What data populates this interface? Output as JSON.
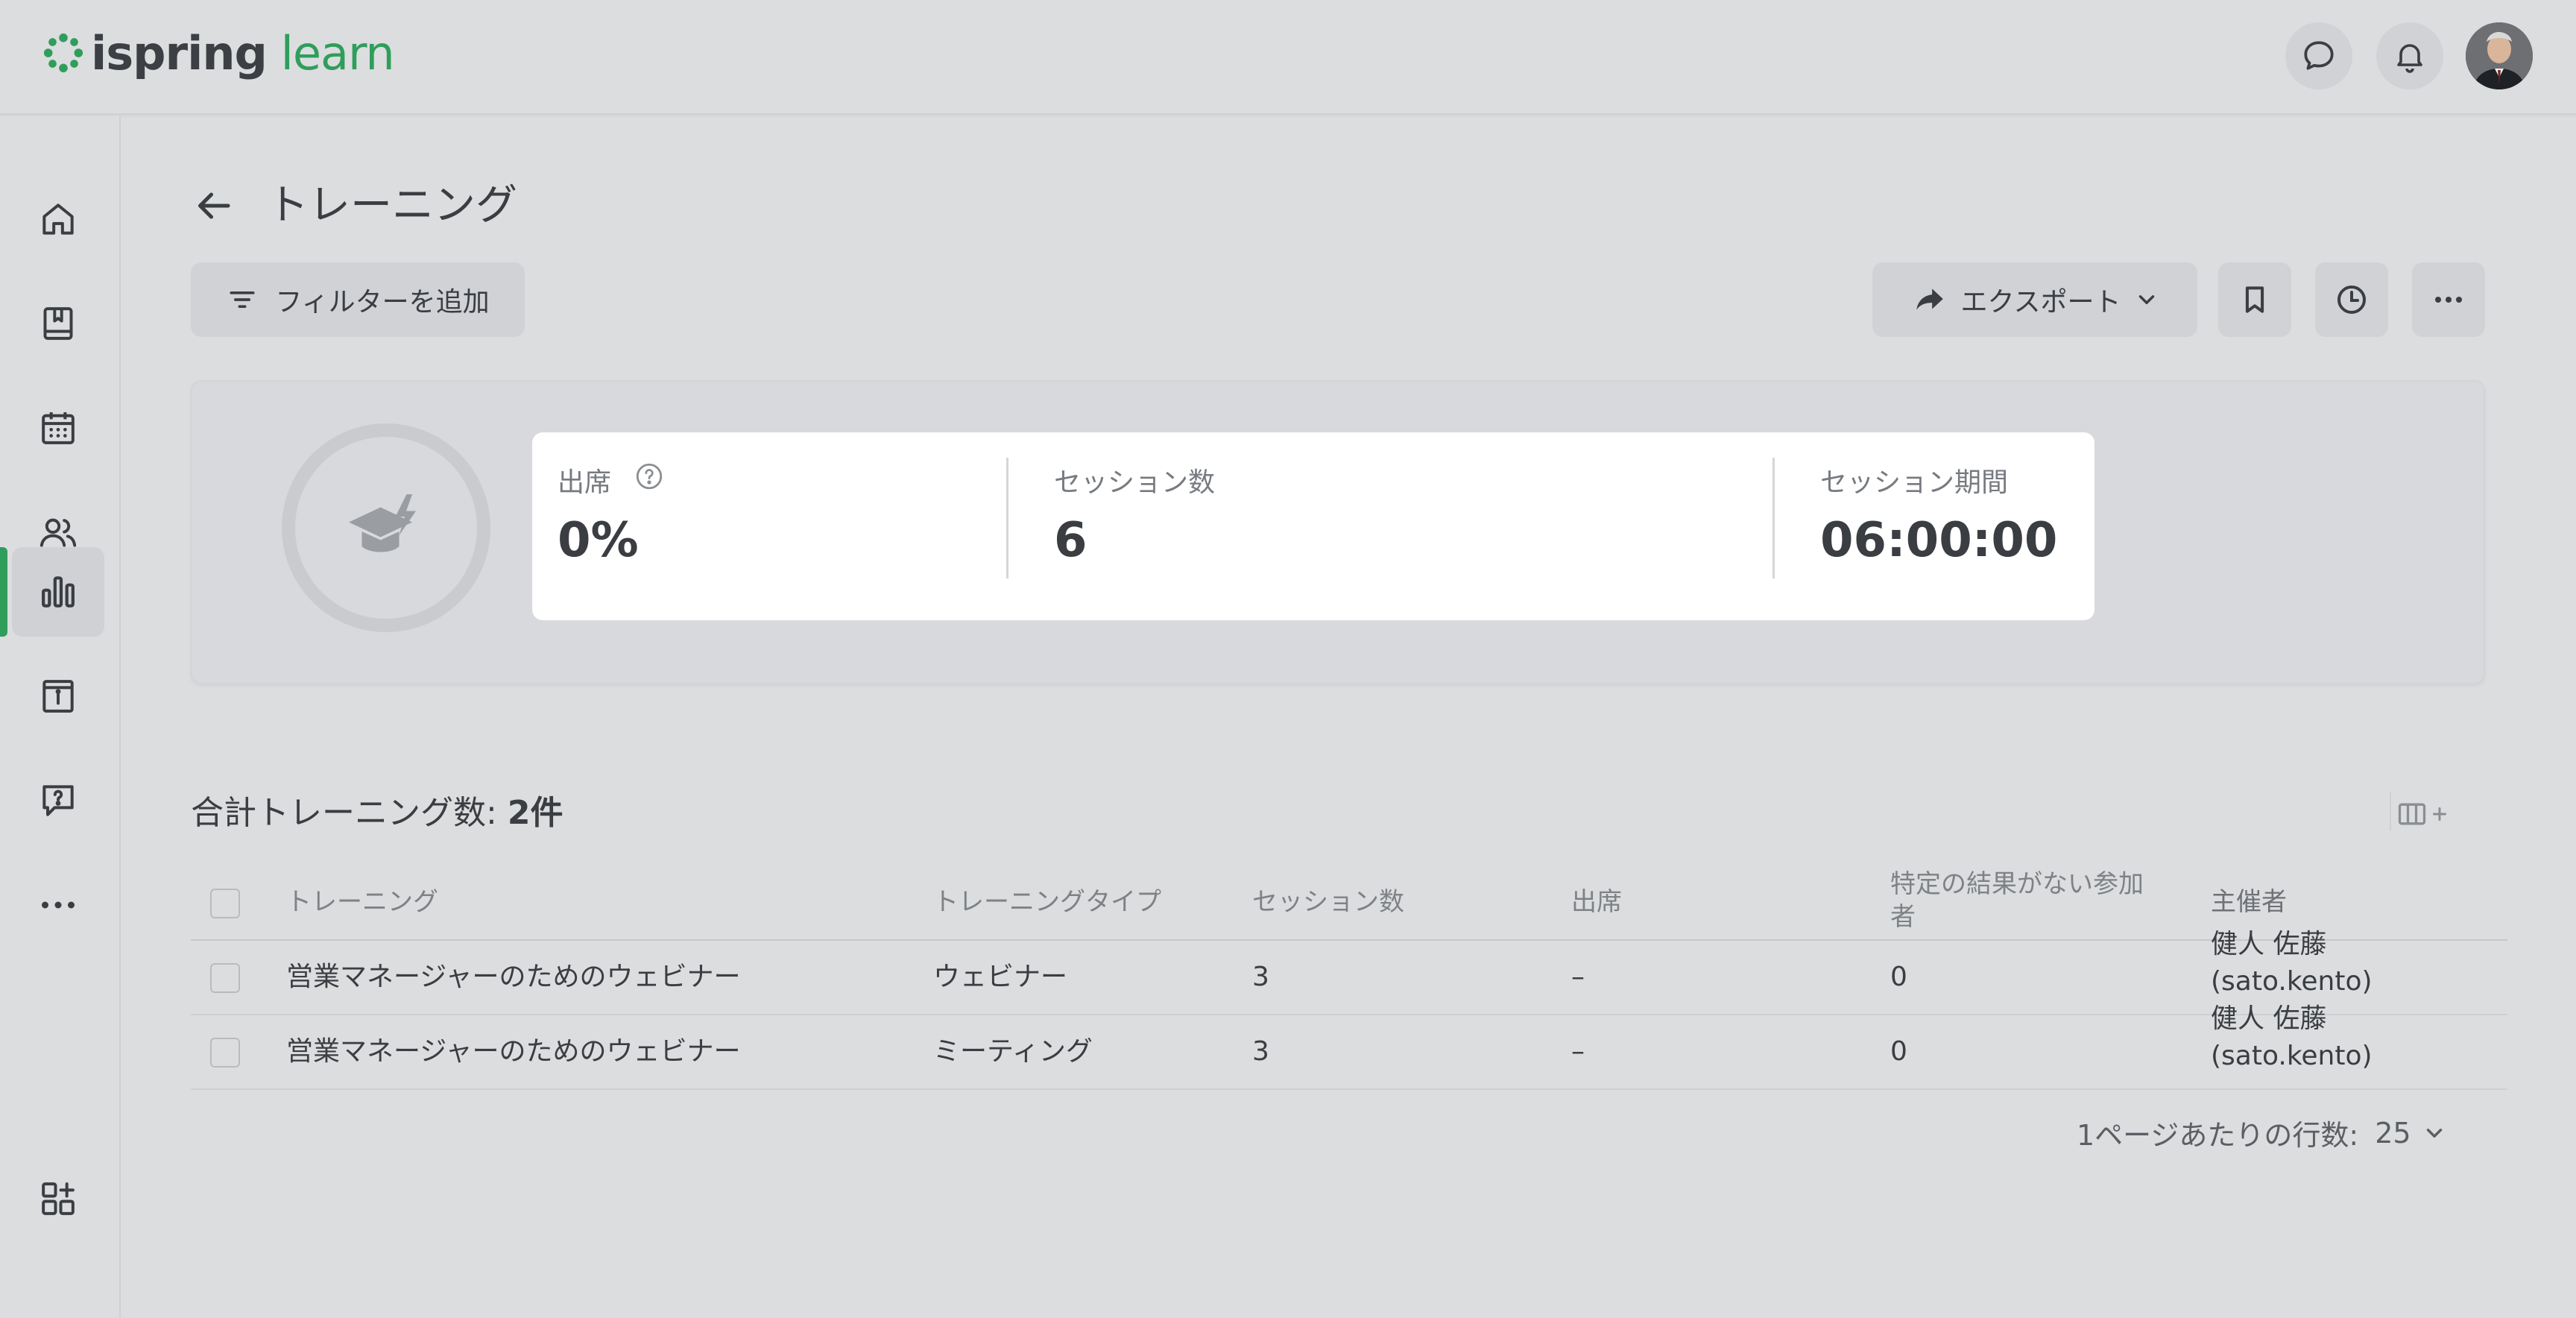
{
  "header": {
    "logo_text_1": "ispring",
    "logo_text_2": "learn",
    "brand_color": "#2f9e5b"
  },
  "sidebar": {
    "items": [
      {
        "name": "home-icon"
      },
      {
        "name": "book-icon"
      },
      {
        "name": "calendar-icon"
      },
      {
        "name": "users-icon"
      },
      {
        "name": "chart-icon",
        "active": true
      },
      {
        "name": "info-icon"
      },
      {
        "name": "help-chat-icon"
      },
      {
        "name": "more-icon"
      },
      {
        "name": "add-widget-icon"
      }
    ]
  },
  "page": {
    "title": "トレーニング"
  },
  "toolbar": {
    "filter_label": "フィルターを追加",
    "export_label": "エクスポート"
  },
  "summary": {
    "attendance_label": "出席",
    "attendance_value": "0%",
    "sessions_label": "セッション数",
    "sessions_value": "6",
    "duration_label": "セッション期間",
    "duration_value": "06:00:00"
  },
  "table": {
    "total_label": "合計トレーニング数:",
    "total_count": "2件",
    "columns": {
      "training": "トレーニング",
      "type": "トレーニングタイプ",
      "sessions": "セッション数",
      "attendance": "出席",
      "no_result_1": "特定の結果がない参加",
      "no_result_2": "者",
      "organizer": "主催者"
    },
    "rows": [
      {
        "training": "営業マネージャーのためのウェビナー",
        "type": "ウェビナー",
        "sessions": "3",
        "attendance": "–",
        "no_result": "0",
        "organizer_name": "健人 佐藤",
        "organizer_login": "(sato.kento)"
      },
      {
        "training": "営業マネージャーのためのウェビナー",
        "type": "ミーティング",
        "sessions": "3",
        "attendance": "–",
        "no_result": "0",
        "organizer_name": "健人 佐藤",
        "organizer_login": "(sato.kento)"
      }
    ],
    "rows_per_page_label": "1ページあたりの行数:",
    "rows_per_page_value": "25"
  }
}
